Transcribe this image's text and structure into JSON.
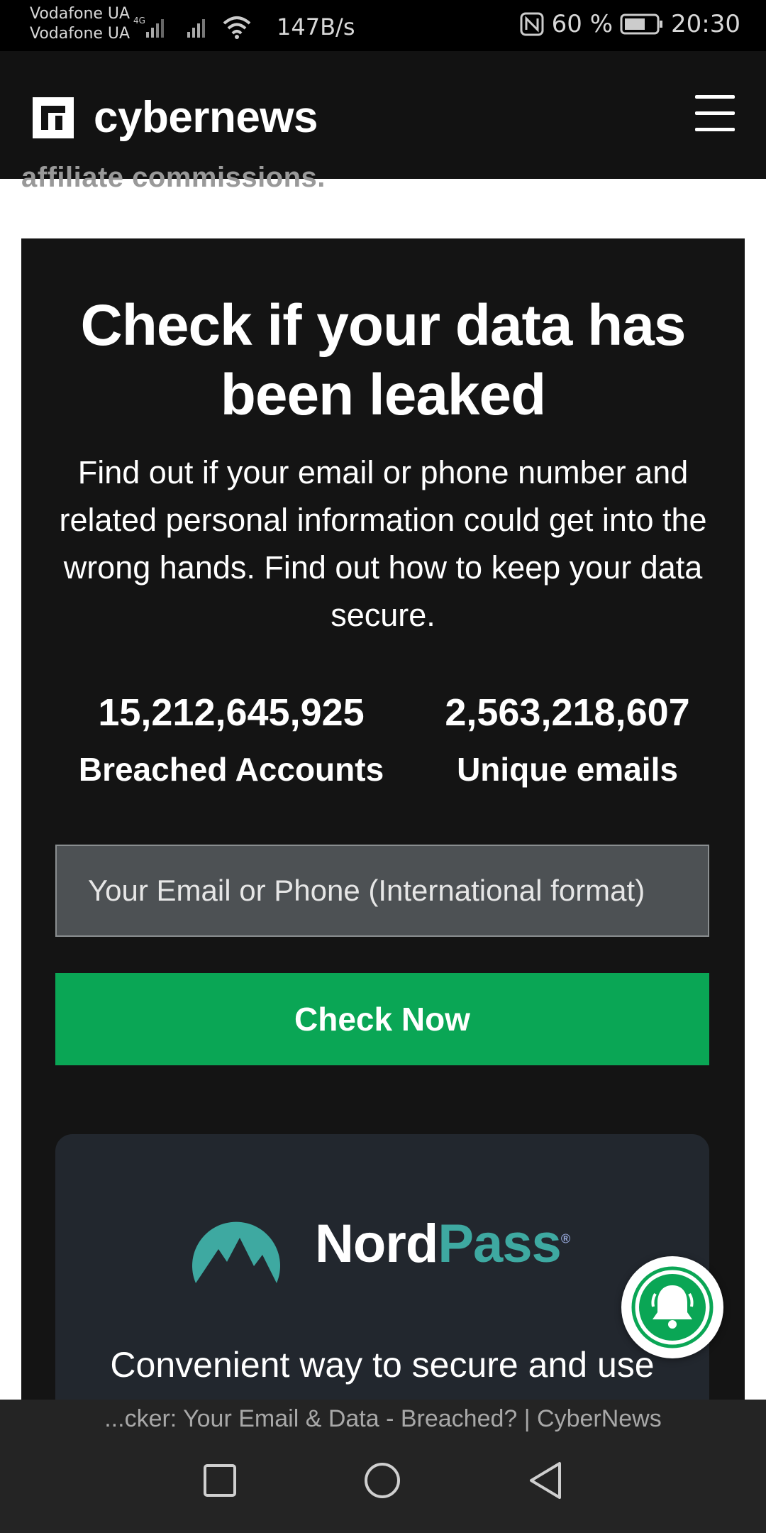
{
  "status_bar": {
    "carrier1": "Vodafone UA",
    "carrier2": "Vodafone UA",
    "network": "4G",
    "speed": "147B/s",
    "battery": "60 %",
    "time": "20:30"
  },
  "header": {
    "brand": "cybernews",
    "icons": [
      "cybernews-logo-icon",
      "hamburger-menu-icon"
    ]
  },
  "page": {
    "cut_text": "affiliate commissions."
  },
  "leak_checker": {
    "title": "Check if your data has been leaked",
    "description": "Find out if your email or phone number and related personal information could get into the wrong hands. Find out how to keep your data secure.",
    "stats": [
      {
        "value": "15,212,645,925",
        "label": "Breached Accounts"
      },
      {
        "value": "2,563,218,607",
        "label": "Unique emails"
      }
    ],
    "input_placeholder": "Your Email or Phone (International format)",
    "button_label": "Check Now",
    "colors": {
      "button": "#0aa655",
      "card": "#141414"
    }
  },
  "promo": {
    "brand_part1": "Nord",
    "brand_part2": "Pass",
    "registered": "®",
    "text": "Convenient way to secure and use",
    "accent": "#3ea9a1"
  },
  "browser": {
    "page_title": "...cker: Your Email & Data - Breached? | CyberNews",
    "nav_icons": [
      "recent-apps-icon",
      "home-icon",
      "back-icon"
    ]
  }
}
